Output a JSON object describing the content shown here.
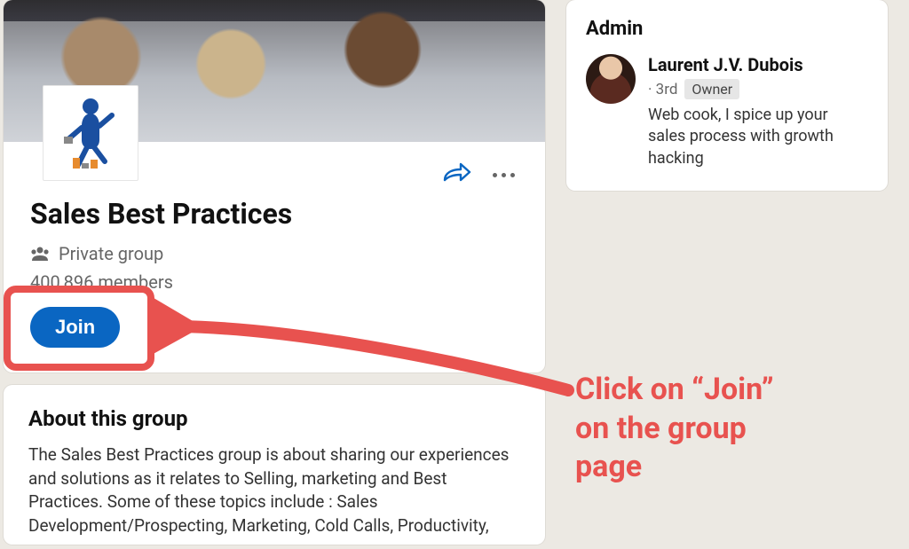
{
  "group": {
    "title": "Sales Best Practices",
    "privacy": "Private group",
    "members": "400,896 members",
    "join_label": "Join"
  },
  "about": {
    "heading": "About this group",
    "body": "The Sales Best Practices group is about sharing our experiences and solutions as it relates to Selling, marketing and Best Practices. Some of these topics include : Sales Development/Prospecting,  Marketing, Cold Calls, Productivity,"
  },
  "admin": {
    "heading": "Admin",
    "name": "Laurent J.V. Dubois",
    "degree": "· 3rd",
    "owner_label": "Owner",
    "bio": "Web cook, I spice up your sales process with growth hacking"
  },
  "annotation": {
    "line1": "Click on “Join”",
    "line2": "on the group",
    "line3": "page"
  }
}
